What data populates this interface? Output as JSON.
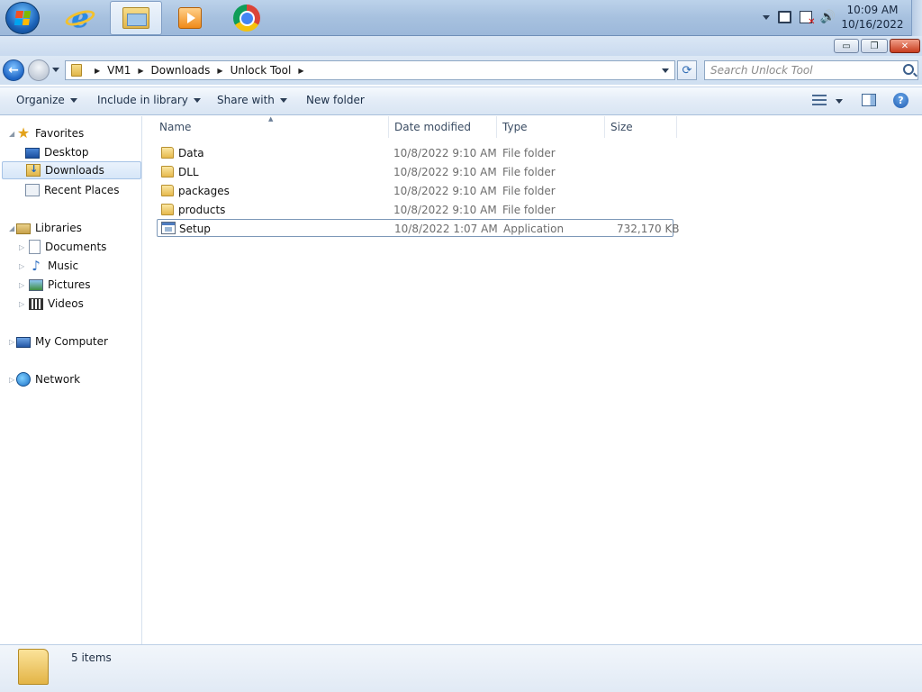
{
  "taskbar": {
    "clock_time": "10:09 AM",
    "clock_date": "10/16/2022",
    "ie_letter": "e"
  },
  "window": {
    "minimize_glyph": "▭",
    "maximize_glyph": "❐",
    "close_glyph": "✕"
  },
  "address": {
    "crumbs": [
      "VM1",
      "Downloads",
      "Unlock Tool"
    ],
    "search_placeholder": "Search Unlock Tool",
    "refresh_glyph": "⟳"
  },
  "toolbar": {
    "organize": "Organize",
    "include_in_library": "Include in library",
    "share_with": "Share with",
    "new_folder": "New folder",
    "help_glyph": "?"
  },
  "navigation": {
    "favorites": "Favorites",
    "desktop": "Desktop",
    "downloads": "Downloads",
    "recent_places": "Recent Places",
    "libraries": "Libraries",
    "documents": "Documents",
    "music": "Music",
    "pictures": "Pictures",
    "videos": "Videos",
    "my_computer": "My Computer",
    "network": "Network"
  },
  "columns": {
    "name": "Name",
    "date_modified": "Date modified",
    "type": "Type",
    "size": "Size"
  },
  "files": [
    {
      "name": "Data",
      "date": "10/8/2022 9:10 AM",
      "type": "File folder",
      "size": ""
    },
    {
      "name": "DLL",
      "date": "10/8/2022 9:10 AM",
      "type": "File folder",
      "size": ""
    },
    {
      "name": "packages",
      "date": "10/8/2022 9:10 AM",
      "type": "File folder",
      "size": ""
    },
    {
      "name": "products",
      "date": "10/8/2022 9:10 AM",
      "type": "File folder",
      "size": ""
    },
    {
      "name": "Setup",
      "date": "10/8/2022 1:07 AM",
      "type": "Application",
      "size": "732,170 KB"
    }
  ],
  "status": {
    "item_count": "5 items"
  },
  "colors": {
    "accent": "#1f62b8",
    "selection": "#d6e6f8",
    "close": "#c83c1e"
  }
}
